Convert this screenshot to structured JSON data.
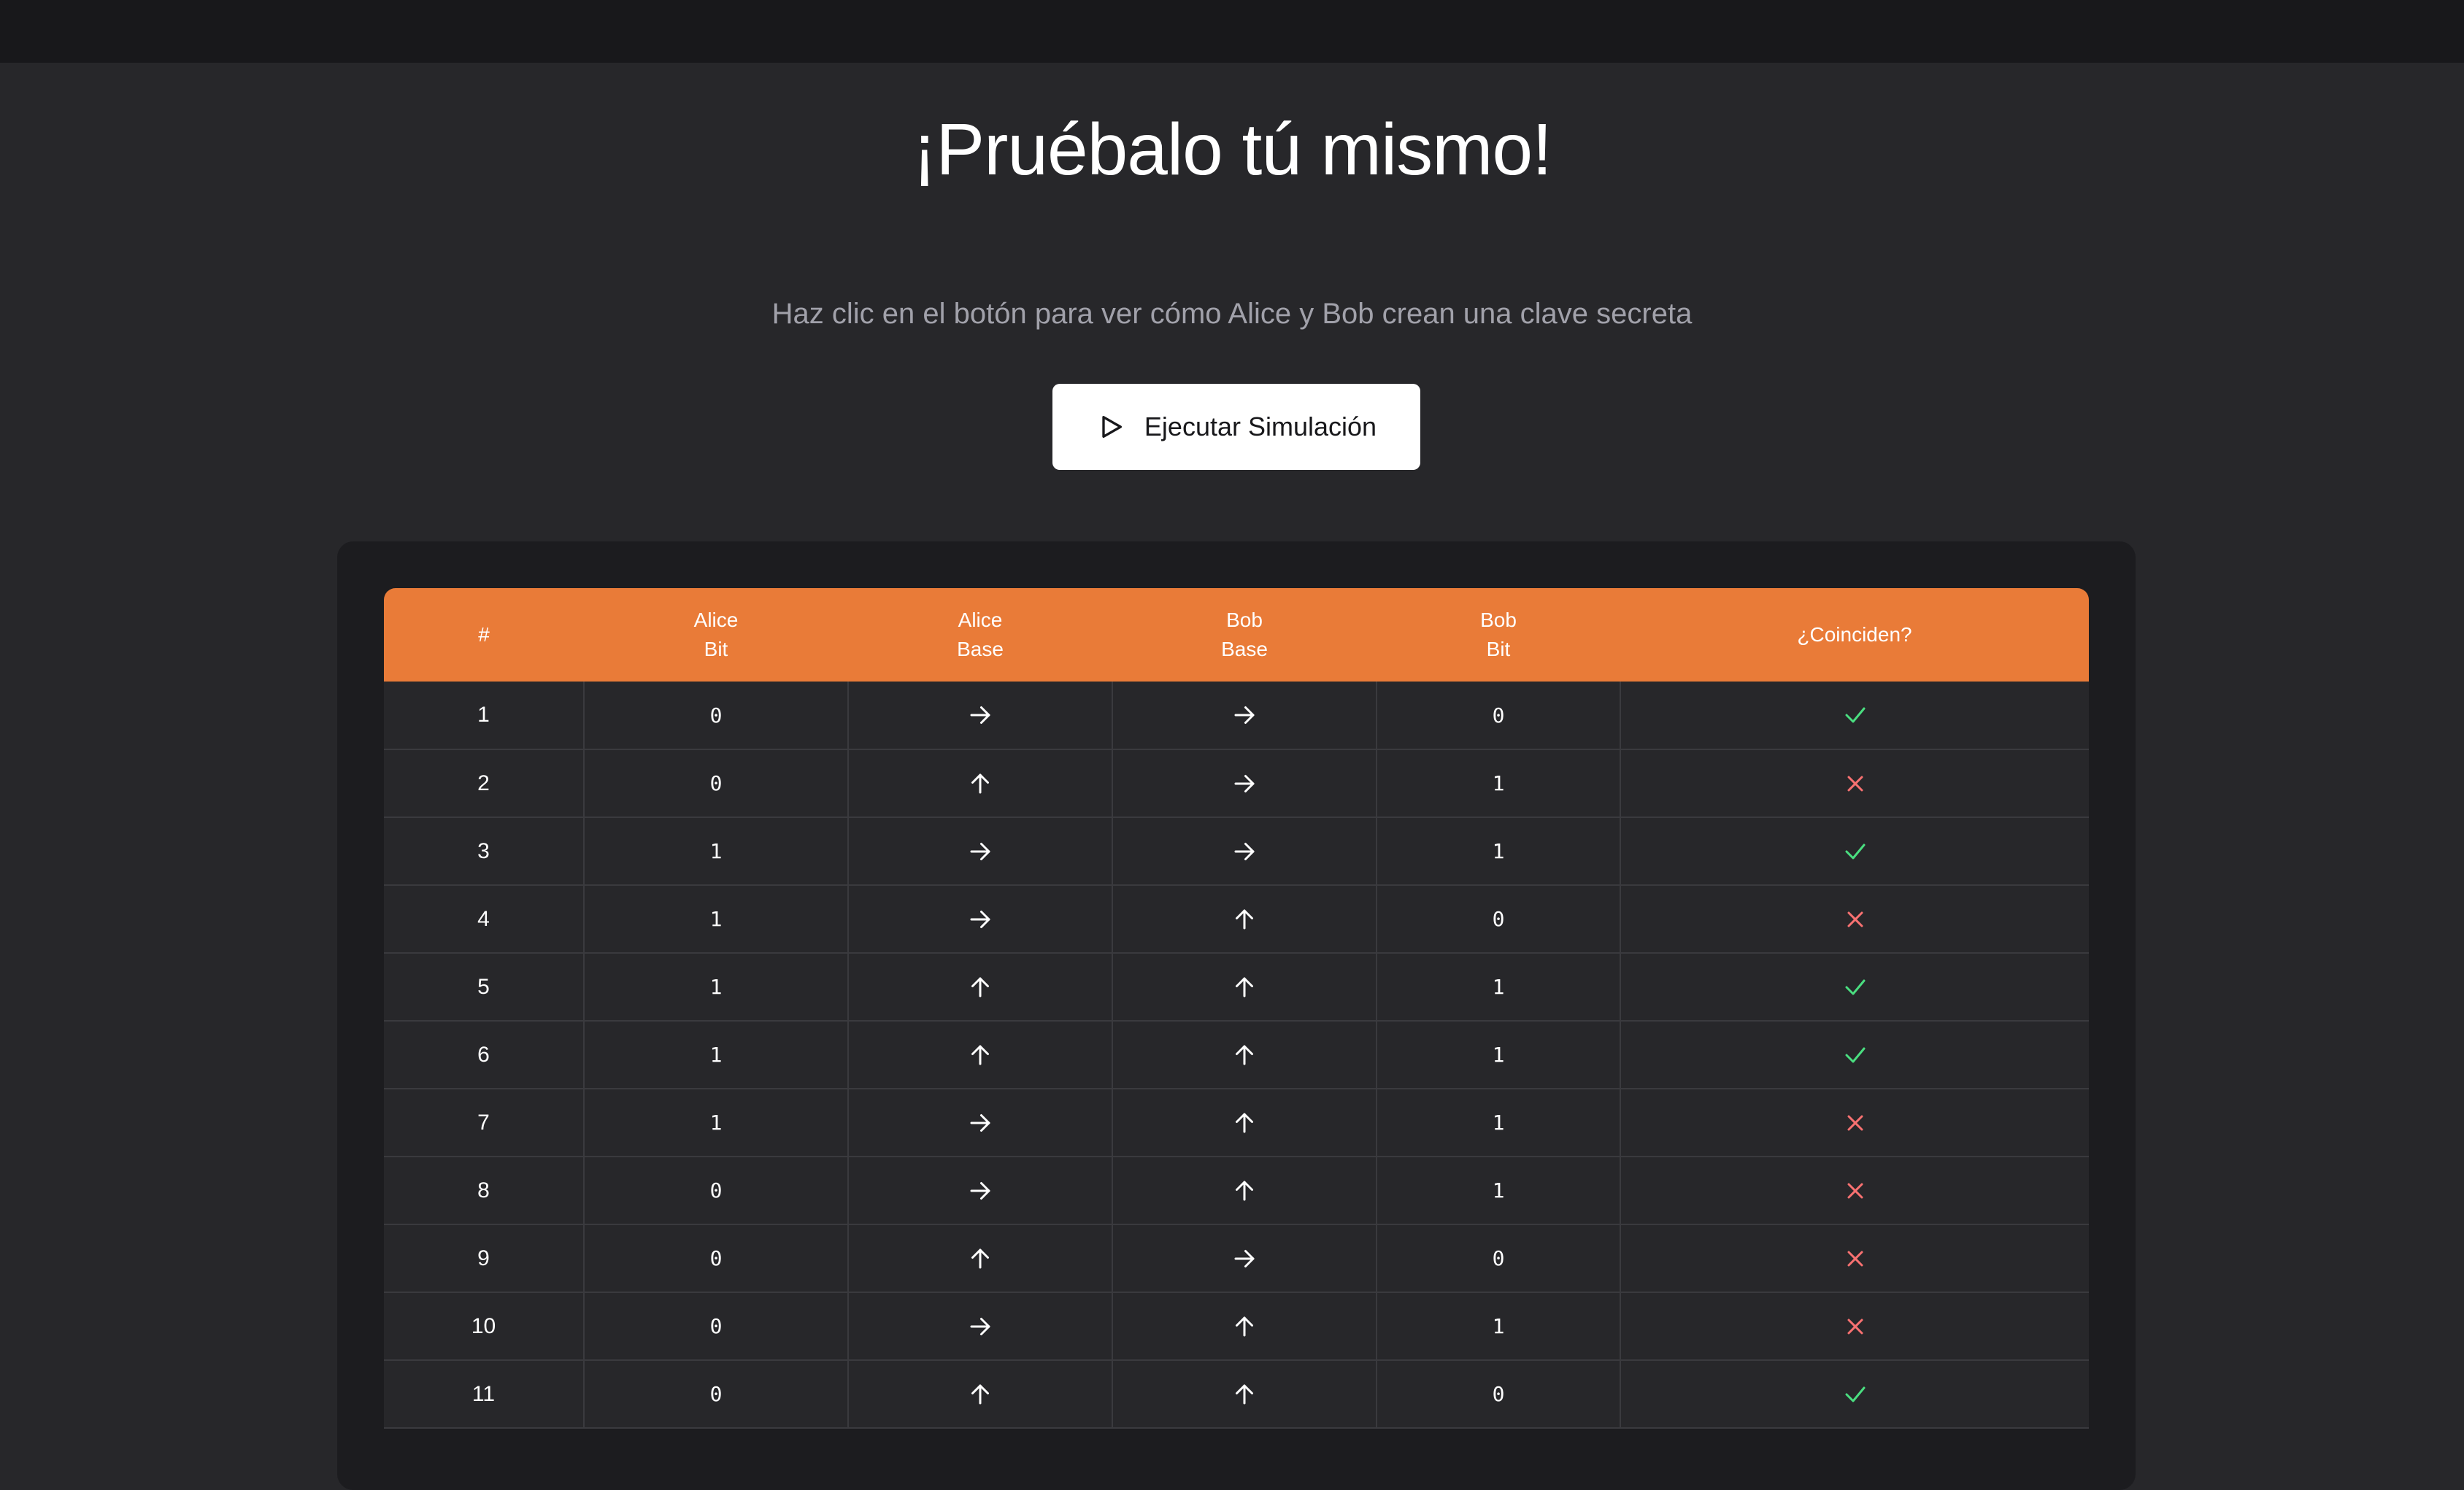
{
  "hero": {
    "title": "¡Pruébalo tú mismo!",
    "subtitle": "Haz clic en el botón para ver cómo Alice y Bob crean una clave secreta",
    "button_label": "Ejecutar Simulación"
  },
  "table": {
    "headers": {
      "index": "#",
      "alice_bit": [
        "Alice",
        "Bit"
      ],
      "alice_base": [
        "Alice",
        "Base"
      ],
      "bob_base": [
        "Bob",
        "Base"
      ],
      "bob_bit": [
        "Bob",
        "Bit"
      ],
      "match": "¿Coinciden?"
    },
    "rows": [
      {
        "n": "1",
        "alice_bit": "0",
        "alice_base": "right",
        "bob_base": "right",
        "bob_bit": "0",
        "match": true
      },
      {
        "n": "2",
        "alice_bit": "0",
        "alice_base": "up",
        "bob_base": "right",
        "bob_bit": "1",
        "match": false
      },
      {
        "n": "3",
        "alice_bit": "1",
        "alice_base": "right",
        "bob_base": "right",
        "bob_bit": "1",
        "match": true
      },
      {
        "n": "4",
        "alice_bit": "1",
        "alice_base": "right",
        "bob_base": "up",
        "bob_bit": "0",
        "match": false
      },
      {
        "n": "5",
        "alice_bit": "1",
        "alice_base": "up",
        "bob_base": "up",
        "bob_bit": "1",
        "match": true
      },
      {
        "n": "6",
        "alice_bit": "1",
        "alice_base": "up",
        "bob_base": "up",
        "bob_bit": "1",
        "match": true
      },
      {
        "n": "7",
        "alice_bit": "1",
        "alice_base": "right",
        "bob_base": "up",
        "bob_bit": "1",
        "match": false
      },
      {
        "n": "8",
        "alice_bit": "0",
        "alice_base": "right",
        "bob_base": "up",
        "bob_bit": "1",
        "match": false
      },
      {
        "n": "9",
        "alice_bit": "0",
        "alice_base": "up",
        "bob_base": "right",
        "bob_bit": "0",
        "match": false
      },
      {
        "n": "10",
        "alice_bit": "0",
        "alice_base": "right",
        "bob_base": "up",
        "bob_bit": "1",
        "match": false
      },
      {
        "n": "11",
        "alice_bit": "0",
        "alice_base": "up",
        "bob_base": "up",
        "bob_bit": "0",
        "match": true
      }
    ]
  },
  "colors": {
    "header_bg": "#e97b38",
    "match_yes": "#4ade80",
    "match_no": "#f87171"
  },
  "icons": {
    "button": "play-icon",
    "base_right": "arrow-right-icon",
    "base_up": "arrow-up-icon",
    "match_yes": "check-icon",
    "match_no": "x-icon"
  }
}
